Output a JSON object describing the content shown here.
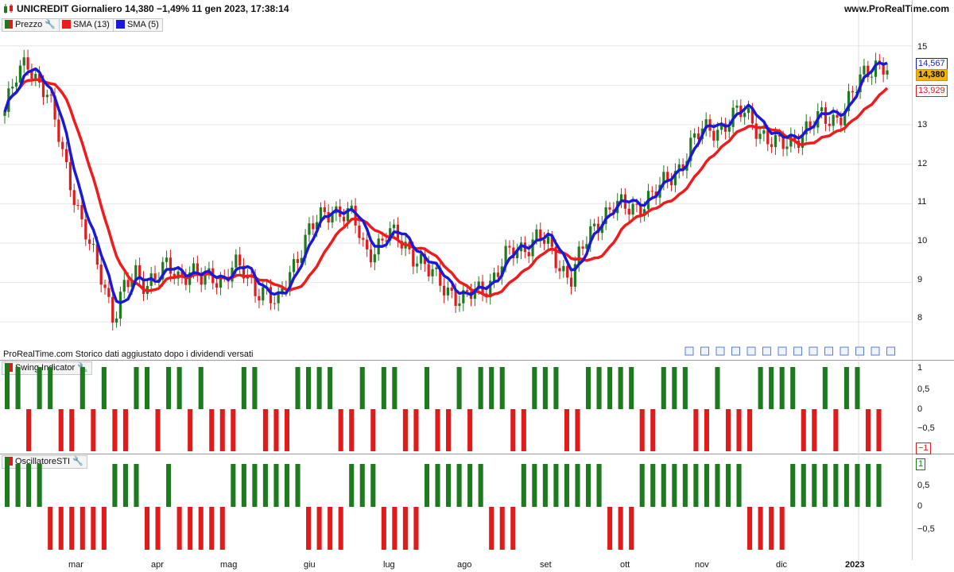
{
  "header": {
    "title": "UNICREDIT Giornaliero 14,380 −1,49% 11 gen 2023, 17:38:14",
    "brand": "www.ProRealTime.com"
  },
  "colors": {
    "up": "#1e7a1e",
    "down": "#e01b1b",
    "sma13": "#ee1c1c",
    "sma5": "#1a1ad6",
    "grid": "#e6e6e6"
  },
  "legend": {
    "price": "Prezzo",
    "sma13": "SMA (13)",
    "sma5": "SMA (5)",
    "swing": "Swing Indicator",
    "sti": "OscillatoreSTI"
  },
  "badges": {
    "sma5_value": "14,567",
    "last_price": "14,380",
    "sma13_value": "13,929",
    "swing_value": "−1",
    "sti_value": "1"
  },
  "note": "ProRealTime.com Storico dati aggiustato dopo i dividendi versati",
  "chart_data": [
    {
      "type": "candlestick",
      "title": "UNICREDIT Giornaliero",
      "x_labels": [
        "mar",
        "apr",
        "mag",
        "giu",
        "lug",
        "ago",
        "set",
        "ott",
        "nov",
        "dic",
        "2023"
      ],
      "y_ticks": [
        "15",
        "14",
        "13",
        "12",
        "11",
        "10",
        "9",
        "8"
      ],
      "ylim": [
        7.3,
        15.6
      ],
      "grid": true,
      "close_series": [
        13.2,
        14.2,
        14.8,
        14.0,
        13.6,
        12.8,
        11.6,
        10.4,
        9.8,
        9.2,
        8.0,
        8.8,
        9.3,
        9.0,
        9.1,
        9.4,
        9.2,
        9.3,
        9.0,
        9.2,
        9.1,
        9.4,
        9.2,
        8.9,
        8.8,
        8.3,
        9.2,
        9.8,
        10.3,
        10.6,
        10.9,
        10.8,
        10.6,
        9.8,
        9.9,
        10.2,
        10.1,
        9.9,
        9.6,
        9.2,
        9.0,
        8.8,
        8.5,
        8.7,
        8.9,
        9.2,
        9.6,
        9.8,
        10.0,
        10.2,
        9.8,
        9.4,
        9.2,
        9.8,
        10.3,
        10.8,
        11.0,
        10.8,
        10.9,
        11.2,
        11.3,
        11.6,
        12.0,
        12.5,
        12.8,
        12.9,
        13.0,
        13.2,
        13.3,
        13.0,
        12.6,
        12.4,
        12.6,
        12.8,
        12.9,
        13.2,
        13.2,
        13.3,
        13.8,
        14.4,
        14.6,
        14.38
      ],
      "sma13_last": 13.929,
      "sma5_last": 14.567,
      "last_price": 14.38
    },
    {
      "type": "bar",
      "title": "Swing Indicator",
      "y_ticks": [
        "1",
        "0,5",
        "0",
        "−0,5"
      ],
      "ylim": [
        -1,
        1
      ],
      "values": [
        1,
        1,
        -1,
        1,
        1,
        -1,
        -1,
        1,
        -1,
        1,
        -1,
        -1,
        1,
        1,
        -1,
        1,
        1,
        -1,
        1,
        -1,
        -1,
        -1,
        1,
        1,
        -1,
        -1,
        -1,
        1,
        1,
        1,
        1,
        -1,
        -1,
        1,
        -1,
        1,
        1,
        -1,
        -1,
        1,
        -1,
        -1,
        1,
        -1,
        1,
        1,
        1,
        -1,
        -1,
        1,
        1,
        1,
        -1,
        -1,
        1,
        1,
        1,
        1,
        1,
        -1,
        -1,
        1,
        1,
        1,
        -1,
        -1,
        1,
        -1,
        -1,
        -1,
        1,
        1,
        1,
        1,
        -1,
        -1,
        1,
        -1,
        1,
        1,
        -1,
        -1
      ]
    },
    {
      "type": "bar",
      "title": "OscillatoreSTI",
      "y_ticks": [
        "1",
        "0,5",
        "0",
        "−0,5"
      ],
      "ylim": [
        -1,
        1
      ],
      "values": [
        1,
        1,
        1,
        1,
        -1,
        -1,
        -1,
        -1,
        -1,
        -1,
        1,
        1,
        1,
        -1,
        -1,
        1,
        -1,
        -1,
        -1,
        -1,
        -1,
        1,
        1,
        1,
        1,
        1,
        1,
        1,
        -1,
        -1,
        -1,
        -1,
        1,
        1,
        1,
        -1,
        -1,
        -1,
        -1,
        1,
        1,
        1,
        1,
        1,
        1,
        -1,
        -1,
        -1,
        1,
        1,
        1,
        1,
        1,
        1,
        1,
        1,
        -1,
        -1,
        -1,
        1,
        1,
        1,
        1,
        1,
        1,
        1,
        1,
        1,
        1,
        -1,
        -1,
        -1,
        -1,
        1,
        1,
        1,
        1,
        1,
        1,
        1,
        1,
        1
      ]
    }
  ]
}
